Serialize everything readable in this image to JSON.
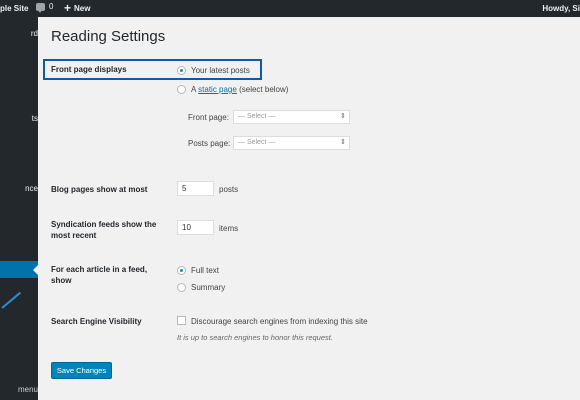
{
  "adminbar": {
    "site_name": "ple Site",
    "comments_count": "0",
    "new_label": "New",
    "howdy": "Howdy, Si"
  },
  "sidebar": {
    "items": [
      "rd",
      "ts",
      "nce"
    ],
    "collapse_label": "menu"
  },
  "page": {
    "title": "Reading Settings"
  },
  "front_page_displays": {
    "label": "Front page displays",
    "latest_posts": "Your latest posts",
    "static_prefix": "A",
    "static_link": "static page",
    "static_suffix": "(select below)",
    "front_page_label": "Front page:",
    "posts_page_label": "Posts page:",
    "select_placeholder": "— Select —"
  },
  "blog_pages": {
    "label": "Blog pages show at most",
    "value": "5",
    "unit": "posts"
  },
  "syndication": {
    "label_line1": "Syndication feeds show the",
    "label_line2": "most recent",
    "value": "10",
    "unit": "items"
  },
  "feed_article": {
    "label_line1": "For each article in a feed,",
    "label_line2": "show",
    "full_text": "Full text",
    "summary": "Summary"
  },
  "search_visibility": {
    "label": "Search Engine Visibility",
    "checkbox_label": "Discourage search engines from indexing this site",
    "note": "It is up to search engines to honor this request."
  },
  "actions": {
    "save_label": "Save Changes"
  }
}
